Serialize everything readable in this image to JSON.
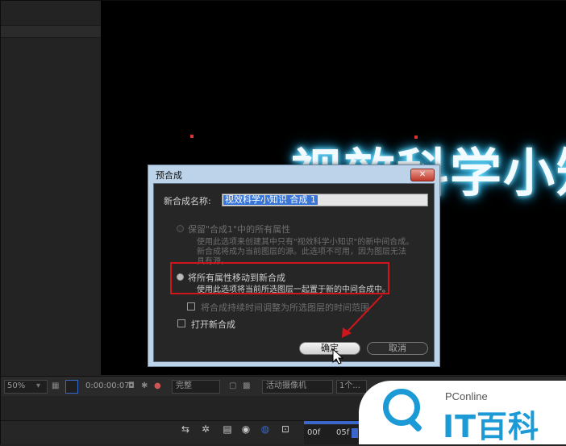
{
  "viewer": {
    "title_text": "视效科学小知识"
  },
  "dialog": {
    "title": "预合成",
    "close_symbol": "✕",
    "name_label": "新合成名称:",
    "name_value": "视效科学小知识 合成 1",
    "option_keep": {
      "label": "保留\"合成1\"中的所有属性",
      "desc_line1": "使用此选项来创建其中只有\"视效科学小知识\"的新中间合成。",
      "desc_line2": "新合成将成为当前图层的源。此选项不可用，因为图层无法",
      "desc_line3": "具有源。"
    },
    "option_move": {
      "label": "将所有属性移动到新合成",
      "desc": "使用此选项将当前所选图层一起置于新的中间合成中。"
    },
    "check_adjust": {
      "label": "将合成持续时间调整为所选图层的时间范围",
      "checked": false
    },
    "check_open": {
      "label": "打开新合成",
      "checked": false
    },
    "ok_label": "确定",
    "cancel_label": "取消"
  },
  "viewer_toolbar": {
    "zoom": "50%",
    "timecode": "0:00:00:07",
    "resolution": "完整",
    "camera": "活动摄像机",
    "views": "1个..."
  },
  "timeline": {
    "ruler_labels": [
      "00f",
      "05f"
    ]
  },
  "watermark": {
    "small_text": "PConline",
    "big_text": "IT百科"
  },
  "colors": {
    "highlight": "#d0161a",
    "accent_blue": "#3a67c9",
    "brand_blue": "#1b9ad6"
  }
}
